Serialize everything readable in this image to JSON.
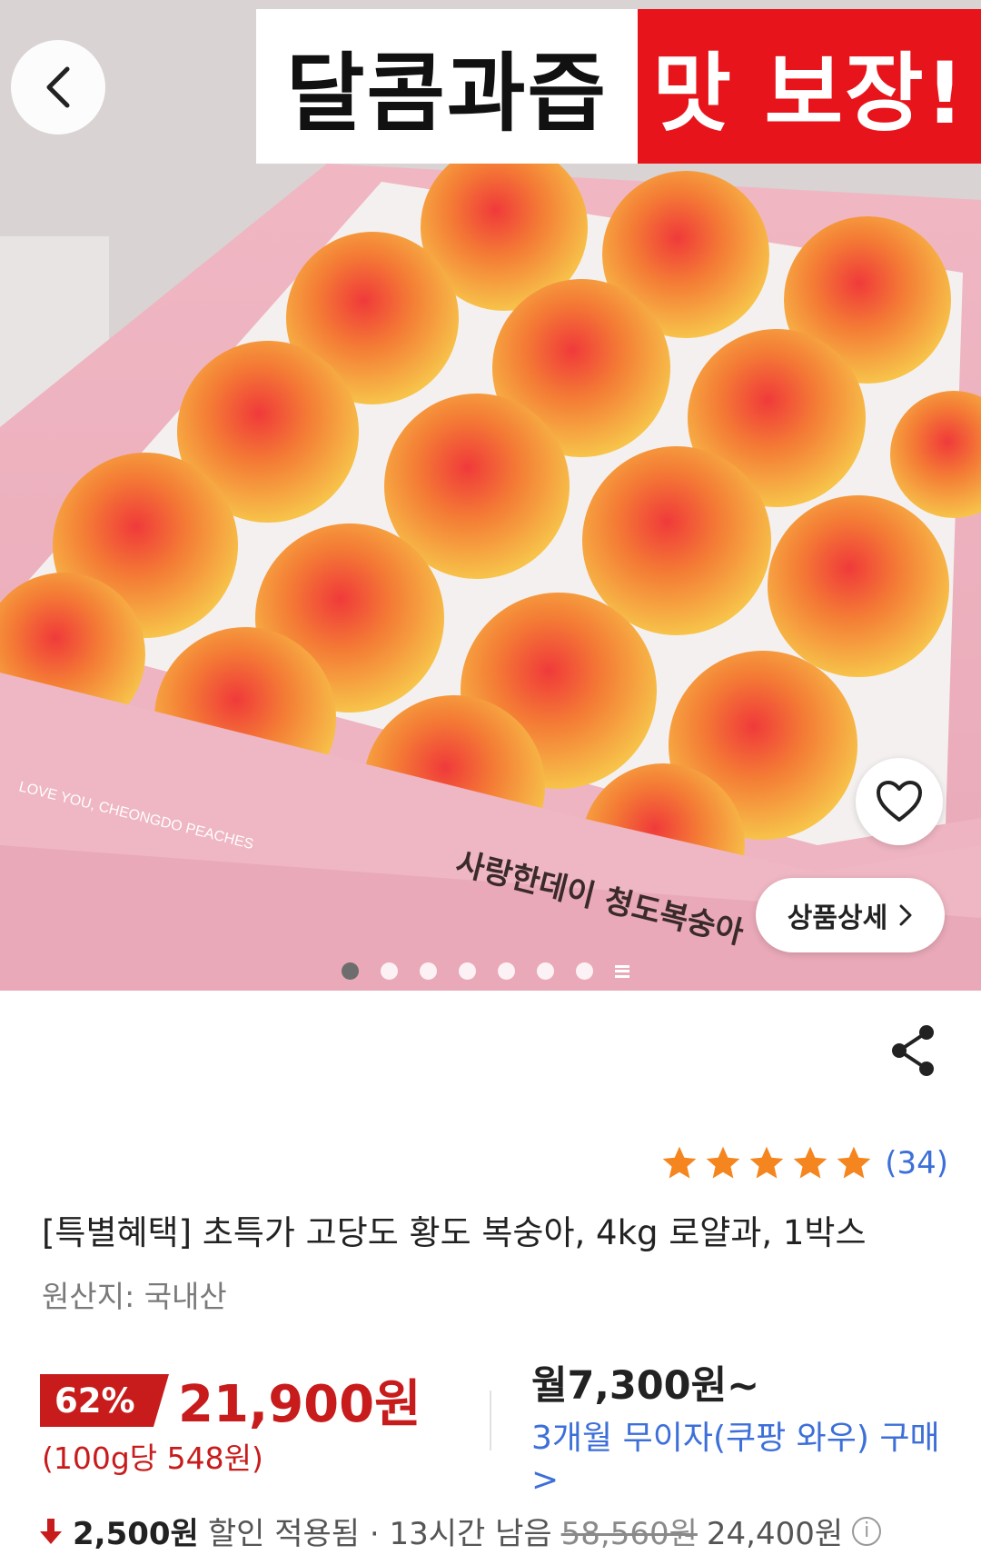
{
  "hero": {
    "banner_left": "달콤과즙",
    "banner_right": "맛 보장!",
    "box_text_en": "LOVE YOU, CHEONGDO PEACHES",
    "box_text_ko": "사랑한데이 청도복숭아",
    "detail_button_label": "상품상세",
    "carousel": {
      "total": 8,
      "active_index": 0
    }
  },
  "product": {
    "title": "[특별혜택] 초특가 고당도 황도 복숭아, 4kg 로얄과, 1박스",
    "origin": "원산지: 국내산",
    "rating": {
      "stars": 5,
      "review_count": "(34)"
    },
    "price": {
      "discount_percent": "62%",
      "sale_price": "21,900원",
      "unit_price": "(100g당 548원)"
    },
    "installment": {
      "monthly": "월7,300원~",
      "description": "3개월 무이자(쿠팡 와우) 구매",
      "arrow": ">"
    },
    "extra_discount": {
      "amount": "2,500원",
      "text": "할인 적용됨 · 13시간 남음",
      "original_price": "58,560원",
      "after_price": "24,400원"
    }
  },
  "colors": {
    "accent_red": "#c81c1c",
    "banner_red": "#e8141b",
    "link_blue": "#3d6fd9",
    "star_orange": "#f5851f"
  },
  "icons": [
    "back-icon",
    "heart-icon",
    "chevron-right-icon",
    "share-icon",
    "star-icon",
    "down-arrow-icon",
    "info-icon"
  ]
}
